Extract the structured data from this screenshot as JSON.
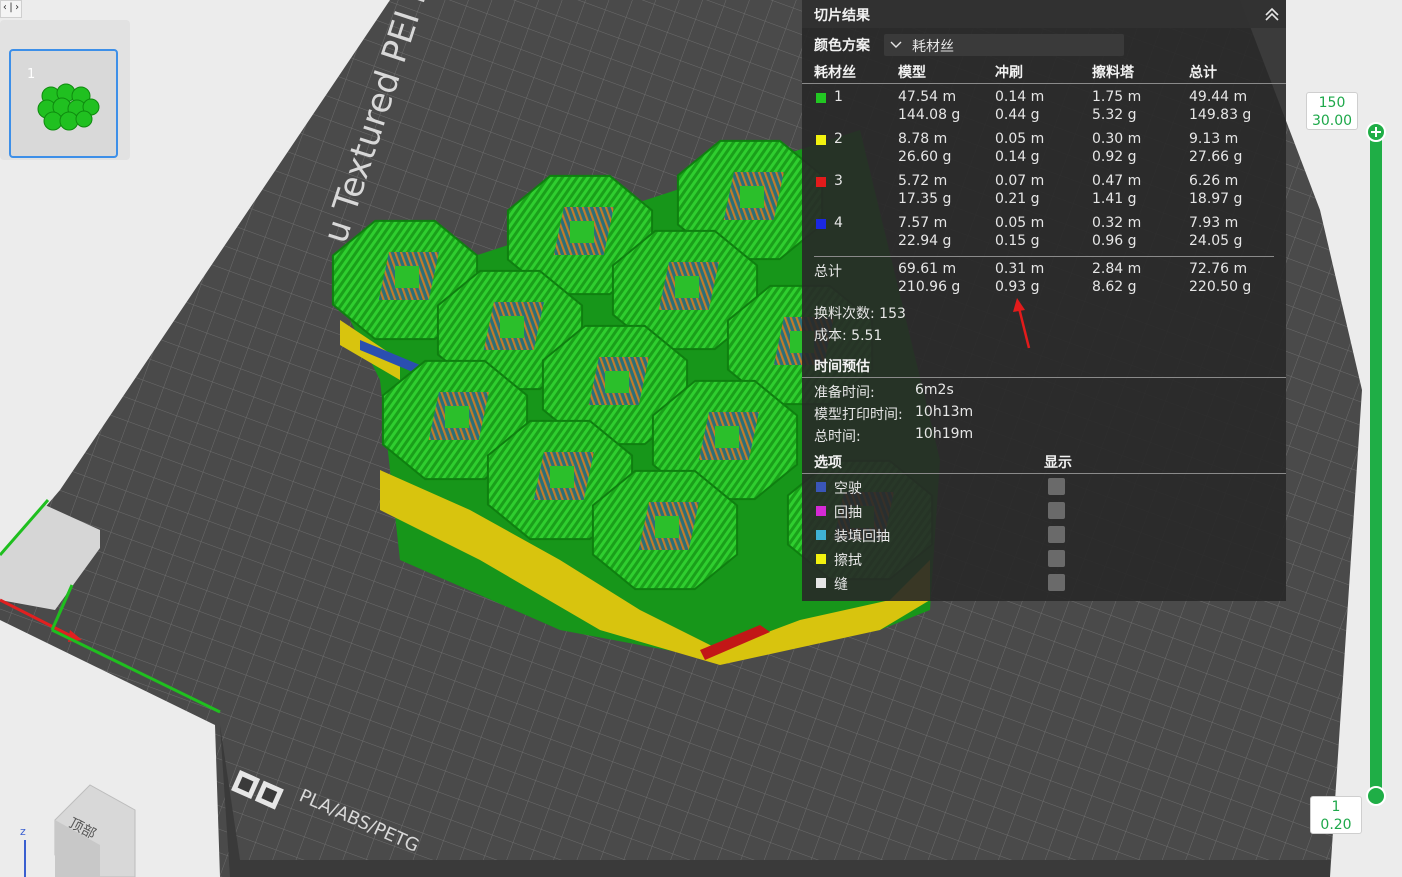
{
  "window": {
    "collapse_icon": "code-toggle-icon",
    "collapse_label": "‹|›"
  },
  "plate_thumbnail": {
    "number": "1"
  },
  "bed": {
    "texture_label": "u Textured PEI Plate",
    "badge_label": "PLA/ABS/PETG"
  },
  "view_cube": {
    "face_label": "顶部",
    "axis_label": "z"
  },
  "slice_panel": {
    "title": "切片结果",
    "collapse_icon": "double-chevron-up-icon",
    "color_scheme_label": "颜色方案",
    "color_scheme_value": "耗材丝",
    "headers": [
      "耗材丝",
      "模型",
      "冲刷",
      "擦料塔",
      "总计"
    ],
    "filaments": [
      {
        "id": "1",
        "color": "#22c722",
        "model": [
          "47.54 m",
          "144.08 g"
        ],
        "flush": [
          "0.14 m",
          "0.44 g"
        ],
        "tower": [
          "1.75 m",
          "5.32 g"
        ],
        "total": [
          "49.44 m",
          "149.83 g"
        ]
      },
      {
        "id": "2",
        "color": "#f2f20f",
        "model": [
          "8.78 m",
          "26.60 g"
        ],
        "flush": [
          "0.05 m",
          "0.14 g"
        ],
        "tower": [
          "0.30 m",
          "0.92 g"
        ],
        "total": [
          "9.13 m",
          "27.66 g"
        ]
      },
      {
        "id": "3",
        "color": "#e21b1b",
        "model": [
          "5.72 m",
          "17.35 g"
        ],
        "flush": [
          "0.07 m",
          "0.21 g"
        ],
        "tower": [
          "0.47 m",
          "1.41 g"
        ],
        "total": [
          "6.26 m",
          "18.97 g"
        ]
      },
      {
        "id": "4",
        "color": "#1b28e2",
        "model": [
          "7.57 m",
          "22.94 g"
        ],
        "flush": [
          "0.05 m",
          "0.15 g"
        ],
        "tower": [
          "0.32 m",
          "0.96 g"
        ],
        "total": [
          "7.93 m",
          "24.05 g"
        ]
      }
    ],
    "sum": {
      "label": "总计",
      "model": [
        "69.61 m",
        "210.96 g"
      ],
      "flush": [
        "0.31 m",
        "0.93 g"
      ],
      "tower": [
        "2.84 m",
        "8.62 g"
      ],
      "total": [
        "72.76 m",
        "220.50 g"
      ]
    },
    "swaps": "换料次数:  153",
    "cost": "成本:  5.51",
    "time_header": "时间预估",
    "times": [
      {
        "label": "准备时间:",
        "value": "6m2s"
      },
      {
        "label": "模型打印时间:",
        "value": "10h13m"
      },
      {
        "label": "总时间:",
        "value": "10h19m"
      }
    ],
    "options_header": "选项",
    "show_header": "显示",
    "options": [
      {
        "label": "空驶",
        "color": "#3a56b8"
      },
      {
        "label": "回抽",
        "color": "#d42ad4"
      },
      {
        "label": "装填回抽",
        "color": "#3fb2d4"
      },
      {
        "label": "擦拭",
        "color": "#f2f20f"
      },
      {
        "label": "缝",
        "color": "#e6e6e6"
      }
    ],
    "annotation_arrow_color": "#e31b1b"
  },
  "layer_slider": {
    "top_layer": "150",
    "top_height": "30.00",
    "bottom_layer": "1",
    "bottom_height": "0.20",
    "color": "#1fae46"
  }
}
